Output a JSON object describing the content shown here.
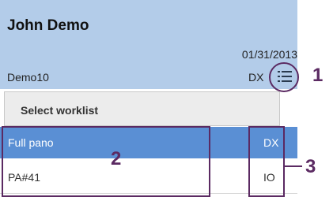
{
  "patient": {
    "name": "John Demo",
    "date": "01/31/2013",
    "exam_id": "Demo10",
    "modality": "DX"
  },
  "worklist": {
    "button_icon": "list-icon",
    "dropdown_label": "Select worklist",
    "items": [
      {
        "name": "Full pano",
        "modality": "DX",
        "selected": true
      },
      {
        "name": "PA#41",
        "modality": "IO",
        "selected": false
      }
    ]
  },
  "callouts": {
    "c1": "1",
    "c2": "2",
    "c3": "3"
  },
  "colors": {
    "header_bg": "#b3cce9",
    "selected_row": "#5a8fd4",
    "annotation": "#5b2a62"
  }
}
